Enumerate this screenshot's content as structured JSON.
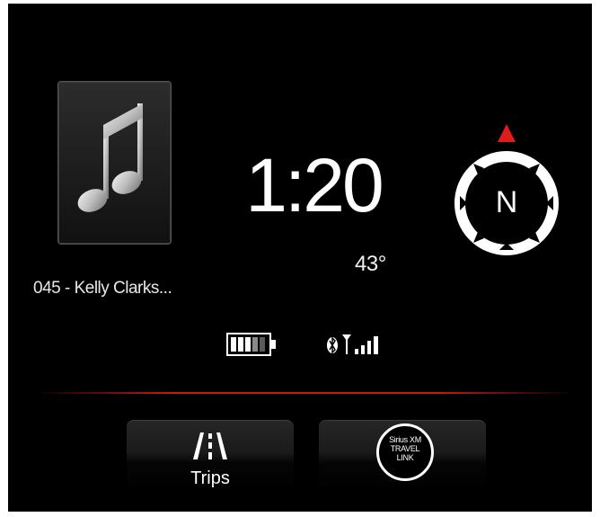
{
  "media": {
    "album_art_icon": "music-note-icon",
    "track_title": "045 - Kelly Clarks..."
  },
  "clock": {
    "time": "1:20"
  },
  "weather": {
    "temperature": "43°"
  },
  "compass": {
    "heading": "N",
    "indicator_color": "#e01b1b"
  },
  "status": {
    "battery_icon": "battery-icon",
    "bluetooth_icon": "bluetooth-icon",
    "signal_icon": "signal-bars-icon"
  },
  "buttons": {
    "trips_label": "Trips",
    "siriusxm": {
      "line1": "Sirius XM",
      "line2": "TRAVEL",
      "line3": "LINK"
    }
  },
  "colors": {
    "accent_red": "#c41a1a",
    "background": "#000000"
  }
}
